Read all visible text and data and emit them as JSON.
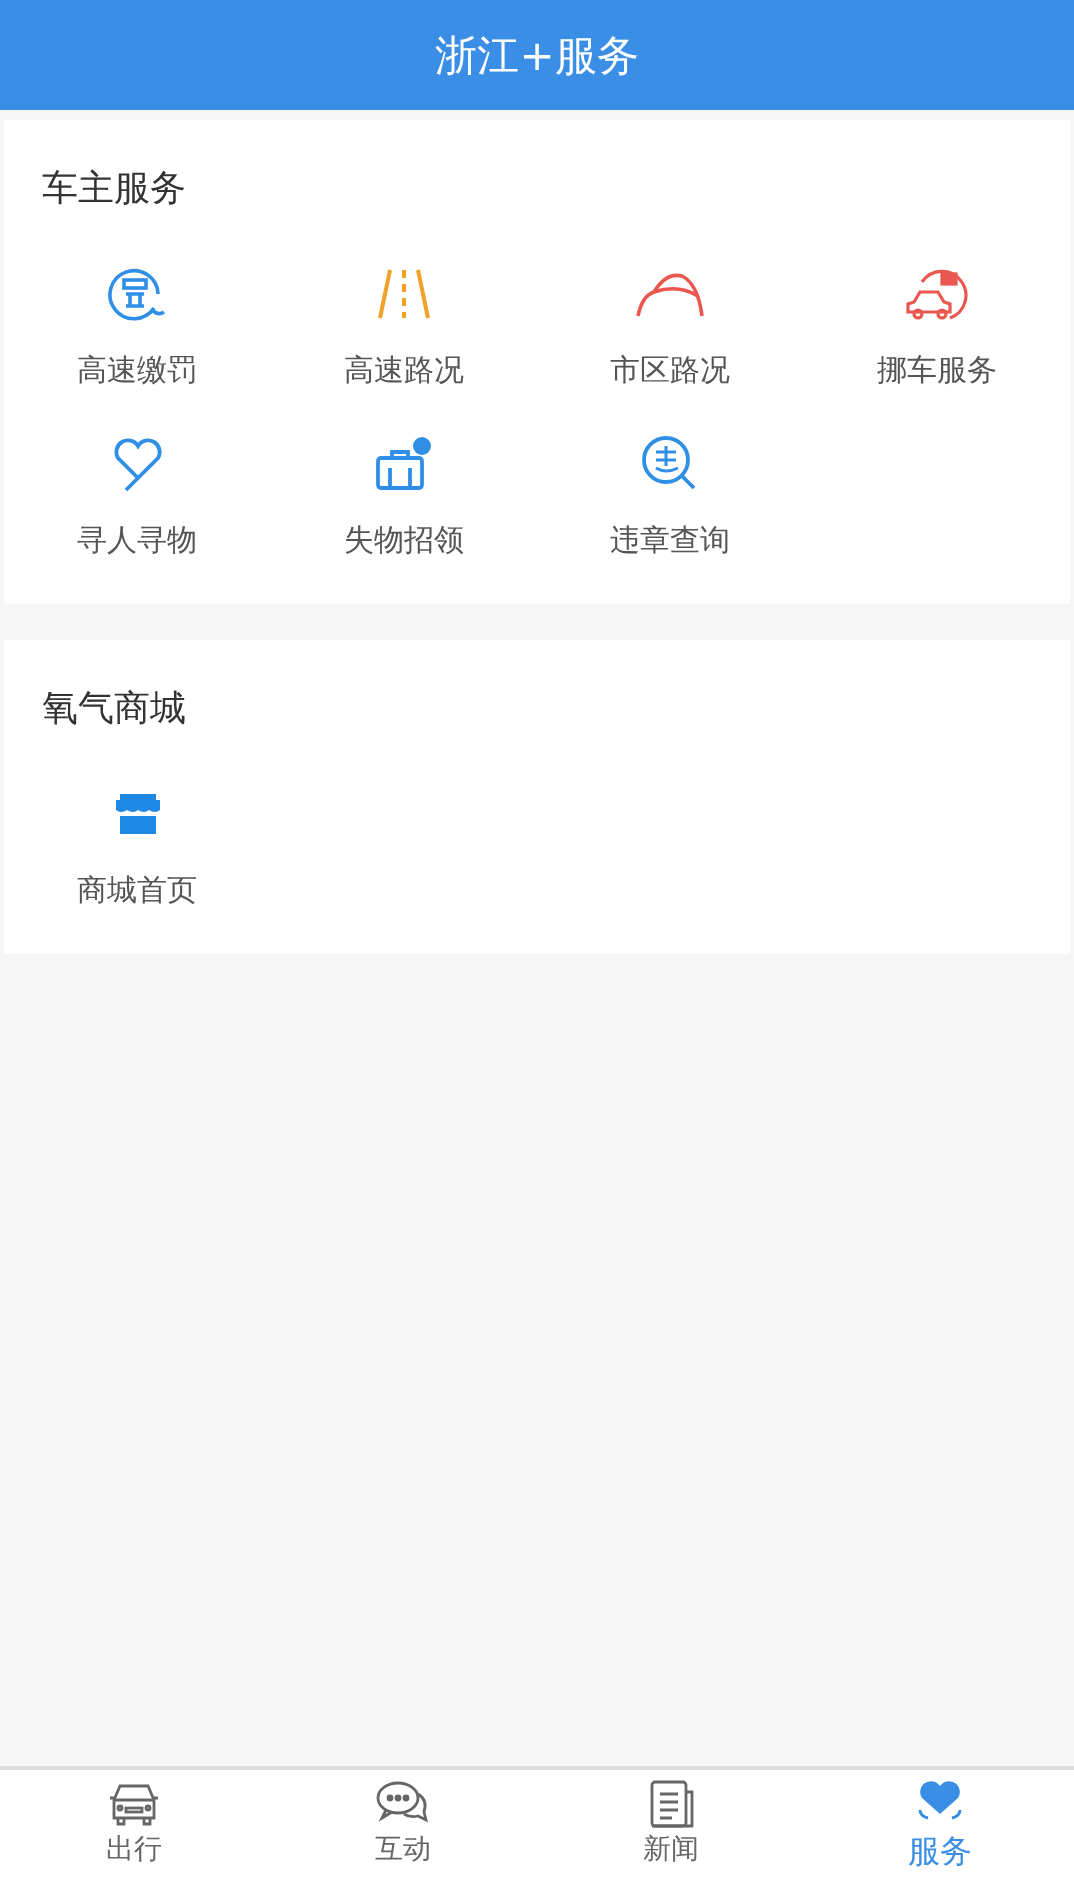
{
  "header": {
    "title": "浙江+服务"
  },
  "sections": [
    {
      "title": "车主服务",
      "items": [
        {
          "label": "高速缴罚",
          "kind": "fine"
        },
        {
          "label": "高速路况",
          "kind": "highway"
        },
        {
          "label": "市区路况",
          "kind": "tunnel"
        },
        {
          "label": "挪车服务",
          "kind": "tow"
        },
        {
          "label": "寻人寻物",
          "kind": "heart"
        },
        {
          "label": "失物招领",
          "kind": "suitcase"
        },
        {
          "label": "违章查询",
          "kind": "violation"
        }
      ]
    },
    {
      "title": "氧气商城",
      "items": [
        {
          "label": "商城首页",
          "kind": "store"
        }
      ]
    }
  ],
  "tabs": [
    {
      "label": "出行",
      "kind": "car",
      "selected": false
    },
    {
      "label": "互动",
      "kind": "chat",
      "selected": false
    },
    {
      "label": "新闻",
      "kind": "news",
      "selected": false
    },
    {
      "label": "服务",
      "kind": "service",
      "selected": true
    }
  ]
}
